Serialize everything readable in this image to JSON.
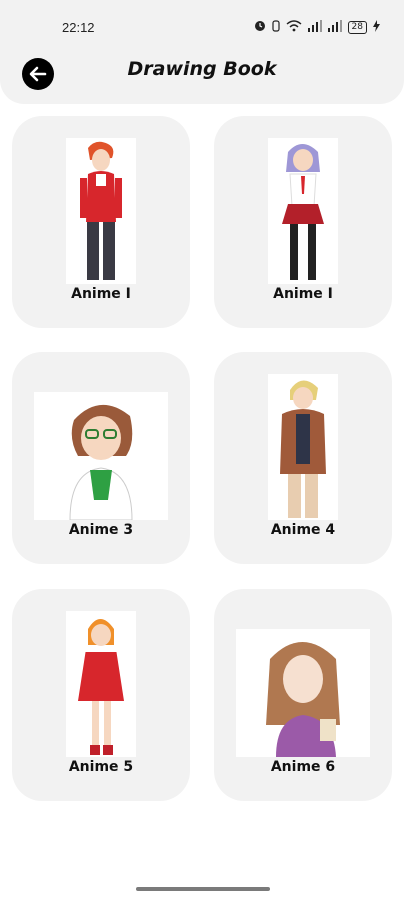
{
  "status": {
    "time": "22:12",
    "battery": "28"
  },
  "header": {
    "title": "Drawing Book",
    "back_icon": "arrow-left-icon"
  },
  "cards": [
    {
      "label": "Anime I"
    },
    {
      "label": "Anime I"
    },
    {
      "label": "Anime 3"
    },
    {
      "label": "Anime 4"
    },
    {
      "label": "Anime 5"
    },
    {
      "label": "Anime 6"
    }
  ],
  "colors": {
    "header_bg": "#f2f2f2",
    "card_bg": "#f2f2f2",
    "back_button": "#000000"
  }
}
